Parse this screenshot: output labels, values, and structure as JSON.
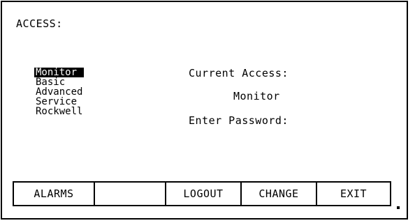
{
  "screen": {
    "title": "ACCESS:"
  },
  "access_levels": {
    "items": [
      {
        "label": "Monitor",
        "selected": true
      },
      {
        "label": "Basic",
        "selected": false
      },
      {
        "label": "Advanced",
        "selected": false
      },
      {
        "label": "Service",
        "selected": false
      },
      {
        "label": "Rockwell",
        "selected": false
      }
    ]
  },
  "status": {
    "current_access_label": "Current Access:",
    "current_access_value": "Monitor",
    "password_label": "Enter Password:"
  },
  "softkeys": [
    {
      "label": "ALARMS"
    },
    {
      "label": ""
    },
    {
      "label": "LOGOUT"
    },
    {
      "label": "CHANGE"
    },
    {
      "label": "EXIT"
    }
  ]
}
